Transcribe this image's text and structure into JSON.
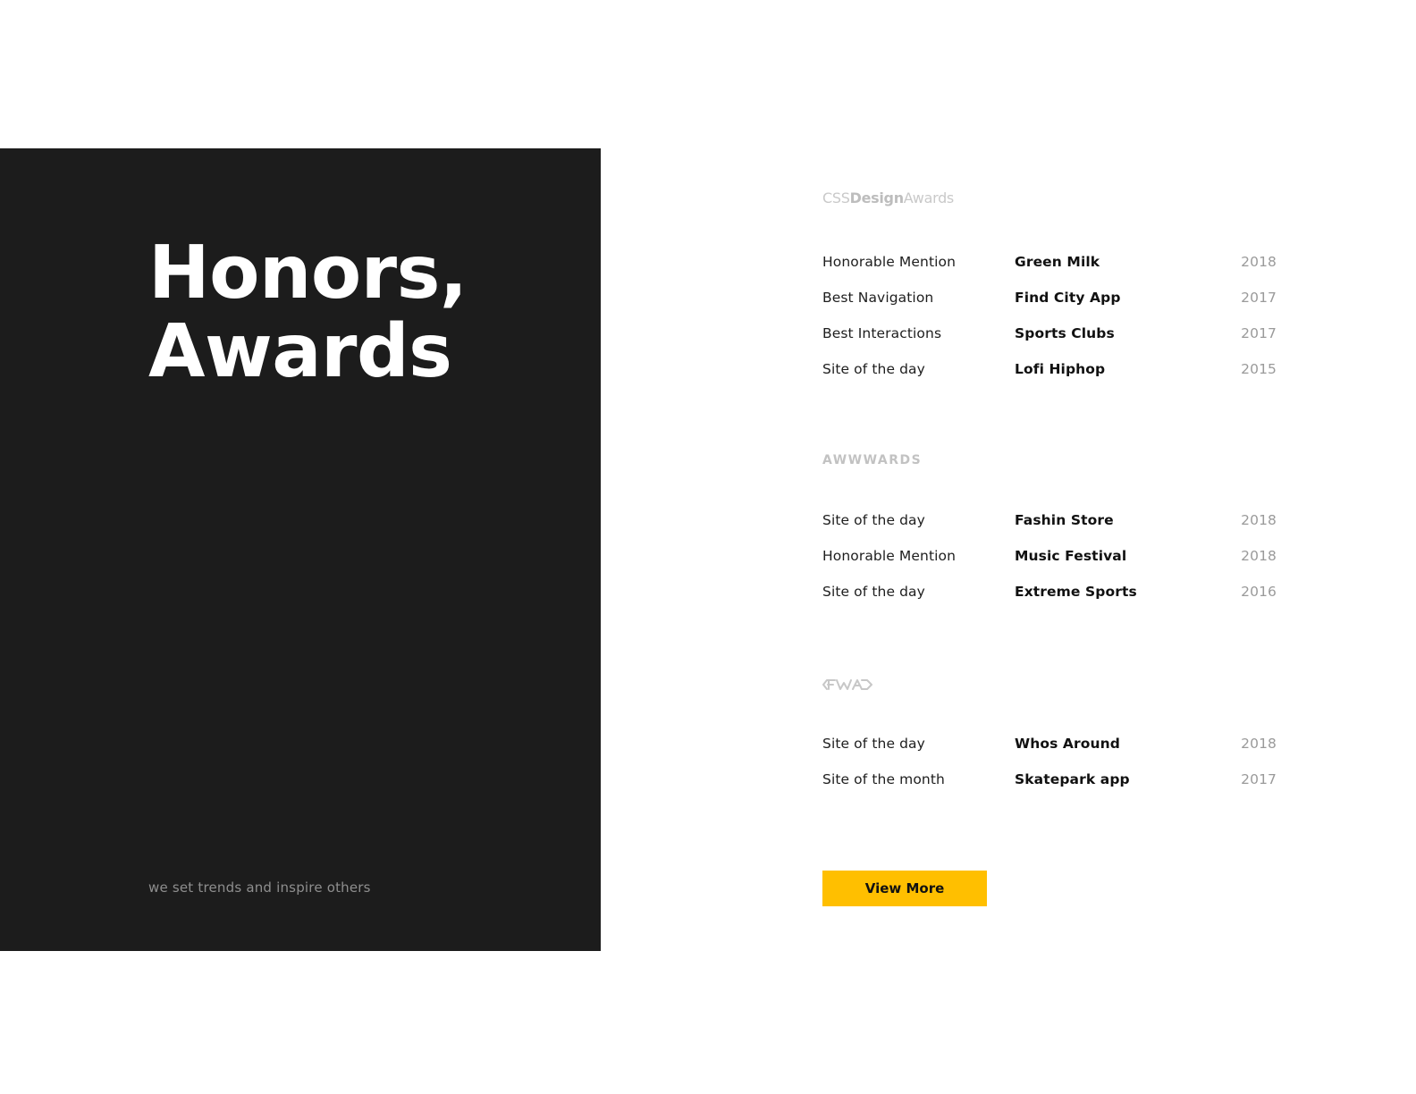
{
  "hero": {
    "title_line1": "Honors,",
    "title_line2": "Awards",
    "tagline": "we set trends and inspire others"
  },
  "sections": [
    {
      "logo_parts": [
        "CSS",
        "Design",
        "Awards"
      ],
      "rows": [
        {
          "category": "Honorable Mention",
          "project": "Green Milk",
          "year": "2018"
        },
        {
          "category": "Best Navigation",
          "project": "Find City App",
          "year": "2017"
        },
        {
          "category": "Best Interactions",
          "project": "Sports Clubs",
          "year": "2017"
        },
        {
          "category": "Site of the day",
          "project": "Lofi Hiphop",
          "year": "2015"
        }
      ]
    },
    {
      "logo": "AWWWARDS",
      "rows": [
        {
          "category": "Site of the day",
          "project": "Fashin Store",
          "year": "2018"
        },
        {
          "category": "Honorable Mention",
          "project": "Music Festival",
          "year": "2018"
        },
        {
          "category": "Site of the day",
          "project": "Extreme Sports",
          "year": "2016"
        }
      ]
    },
    {
      "logo": "FWA",
      "rows": [
        {
          "category": "Site of the day",
          "project": "Whos Around",
          "year": "2018"
        },
        {
          "category": "Site of the month",
          "project": "Skatepark app",
          "year": "2017"
        }
      ]
    }
  ],
  "button": {
    "label": "View More"
  },
  "colors": {
    "panel": "#1c1c1c",
    "accent": "#ffbf00",
    "logo_gray": "#c9c9c9",
    "year_gray": "#9a9a9a"
  }
}
